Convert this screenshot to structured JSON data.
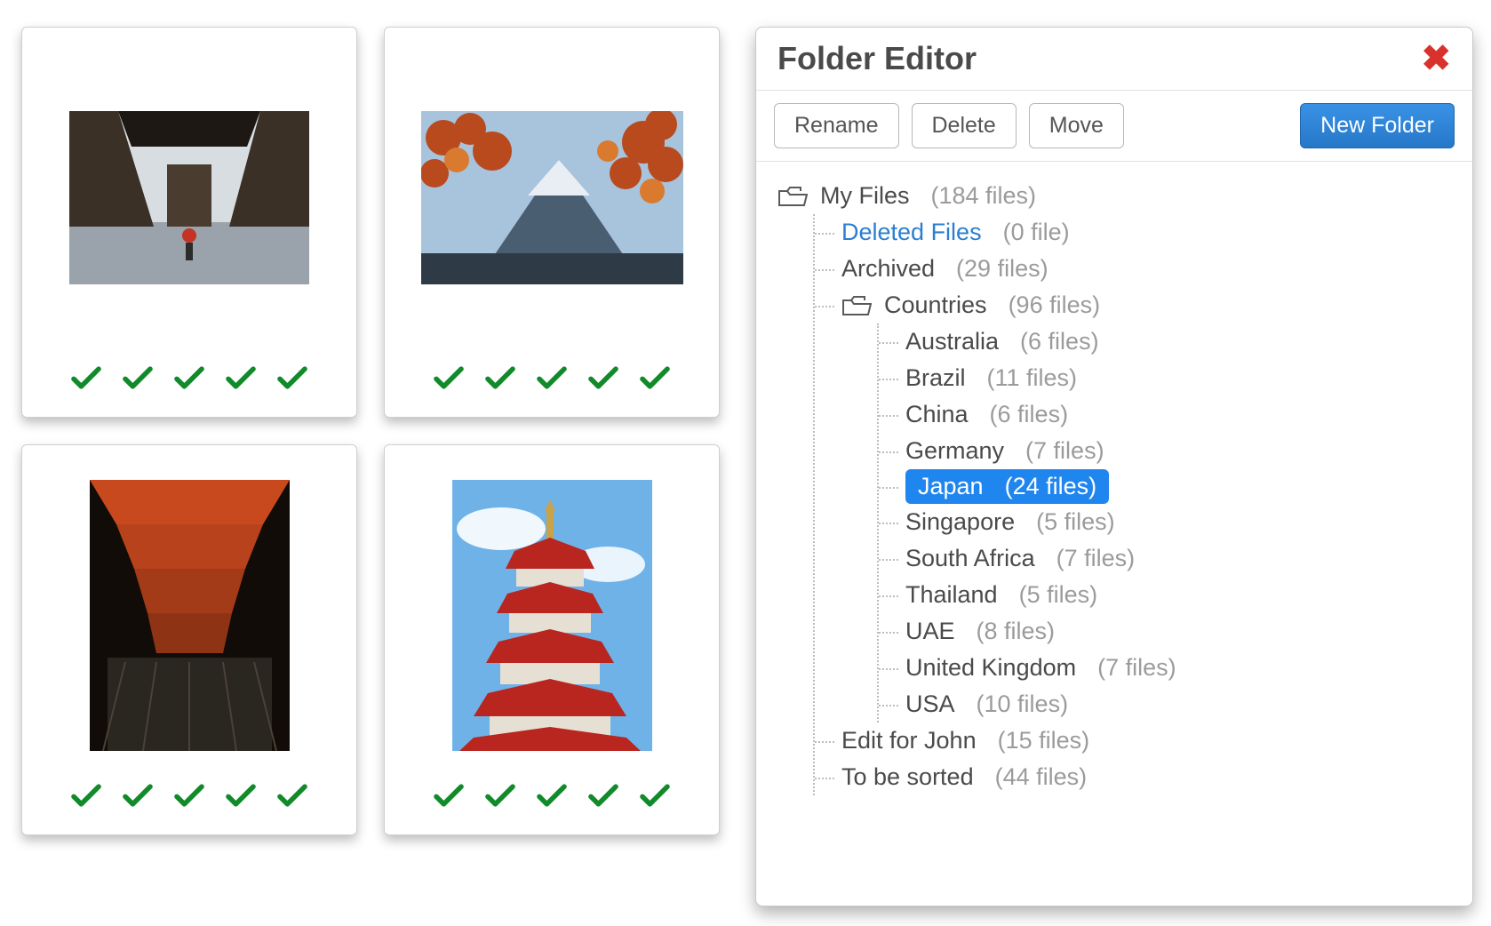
{
  "panel": {
    "title": "Folder Editor",
    "buttons": {
      "rename": "Rename",
      "delete": "Delete",
      "move": "Move",
      "new_folder": "New Folder"
    }
  },
  "tree": {
    "root": {
      "label": "My Files",
      "count": "(184 files)"
    },
    "deleted": {
      "label": "Deleted Files",
      "count": "(0 file)"
    },
    "archived": {
      "label": "Archived",
      "count": "(29 files)"
    },
    "countries": {
      "label": "Countries",
      "count": "(96 files)"
    },
    "country_items": [
      {
        "label": "Australia",
        "count": "(6 files)",
        "selected": false
      },
      {
        "label": "Brazil",
        "count": "(11 files)",
        "selected": false
      },
      {
        "label": "China",
        "count": "(6 files)",
        "selected": false
      },
      {
        "label": "Germany",
        "count": "(7 files)",
        "selected": false
      },
      {
        "label": "Japan",
        "count": "(24 files)",
        "selected": true
      },
      {
        "label": "Singapore",
        "count": "(5 files)",
        "selected": false
      },
      {
        "label": "South Africa",
        "count": "(7 files)",
        "selected": false
      },
      {
        "label": "Thailand",
        "count": "(5 files)",
        "selected": false
      },
      {
        "label": "UAE",
        "count": "(8 files)",
        "selected": false
      },
      {
        "label": "United Kingdom",
        "count": "(7 files)",
        "selected": false
      },
      {
        "label": "USA",
        "count": "(10 files)",
        "selected": false
      }
    ],
    "edit_for_john": {
      "label": "Edit for John",
      "count": "(15 files)"
    },
    "to_be_sorted": {
      "label": "To be sorted",
      "count": "(44 files)"
    }
  },
  "thumbnails": {
    "check_color": "#118a2a",
    "checks_per_card": 5,
    "cards": [
      {
        "name": "thumb-japan-street"
      },
      {
        "name": "thumb-fuji-maple"
      },
      {
        "name": "thumb-torii-gates"
      },
      {
        "name": "thumb-pagoda"
      }
    ]
  }
}
